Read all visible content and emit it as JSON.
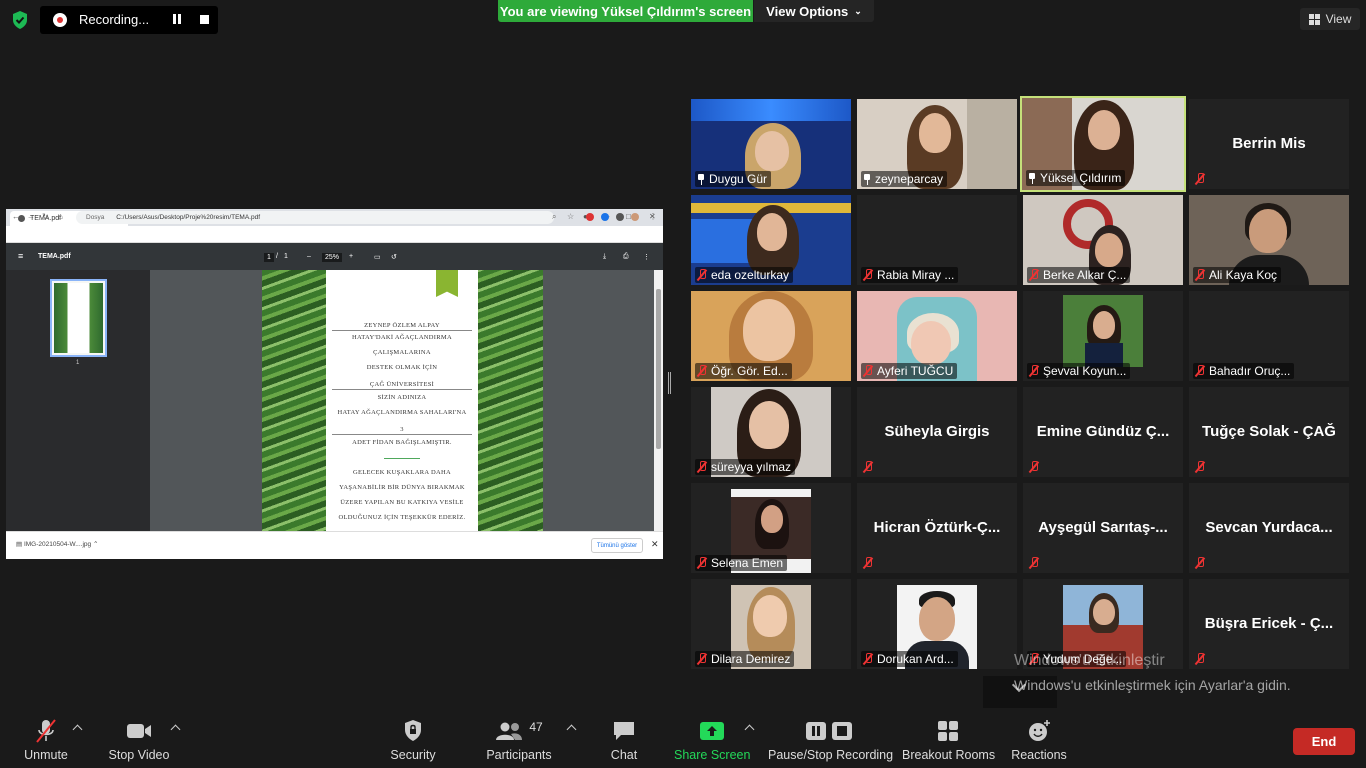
{
  "top": {
    "recording_label": "Recording...",
    "viewing_banner": "You are viewing Yüksel Çıldırım's screen",
    "view_options": "View Options",
    "view": "View"
  },
  "shared_screen": {
    "tab_title": "TEMA.pdf",
    "url_prefix": "Dosya",
    "url": "C:/Users/Asus/Desktop/Proje%20resim/TEMA.pdf",
    "pdf_title": "TEMA.pdf",
    "page_current": "1",
    "page_sep": "/",
    "page_total": "1",
    "zoom": "25%",
    "thumb_page": "1",
    "certificate_lines": [
      "ZEYNEP ÖZLEM ALPAY",
      "HATAY'DAKİ AĞAÇLANDIRMA",
      "ÇALIŞMALARINA",
      "DESTEK OLMAK İÇİN",
      "ÇAĞ ÜNİVERSİTESİ",
      "SİZİN ADINIZA",
      "HATAY AĞAÇLANDIRMA SAHALARI'NA",
      "3",
      "ADET FİDAN BAĞIŞLAMIŞTIR.",
      "GELECEK KUŞAKLARA DAHA",
      "YAŞANABİLİR BİR DÜNYA BIRAKMAK",
      "ÜZERE YAPILAN BU KATKIYA VESİLE",
      "OLDUĞUNUZ İÇİN TEŞEKKÜR EDERİZ."
    ],
    "download_file": "IMG-20210504-W....jpg",
    "show_all": "Tümünü göster"
  },
  "participants": [
    {
      "name": "Duygu Gür",
      "icon": "pin-icon"
    },
    {
      "name": "zeyneparcay",
      "icon": "pin-icon"
    },
    {
      "name": "Yüksel Çıldırım",
      "icon": "pin-icon"
    },
    {
      "name": "Berrin Mis",
      "icon": "mute-icon"
    },
    {
      "name": "eda ozelturkay",
      "icon": "mute-icon"
    },
    {
      "name": "Rabia Miray ...",
      "icon": "mute-icon"
    },
    {
      "name": "Berke Alkar Ç...",
      "icon": "mute-icon"
    },
    {
      "name": "Ali Kaya Koç",
      "icon": "mute-icon"
    },
    {
      "name": "Öğr. Gör. Ed...",
      "icon": "mute-icon"
    },
    {
      "name": "Ayferi TUĞCU",
      "icon": "mute-icon"
    },
    {
      "name": "Şevval Koyun...",
      "icon": "mute-icon"
    },
    {
      "name": "Bahadır Oruç...",
      "icon": "mute-icon"
    },
    {
      "name": "süreyya yılmaz",
      "icon": "mute-icon"
    },
    {
      "name": "Süheyla Girgis",
      "icon": "mute-icon"
    },
    {
      "name": "Emine Gündüz Ç...",
      "icon": "mute-icon"
    },
    {
      "name": "Tuğçe Solak - ÇAĞ",
      "icon": "mute-icon"
    },
    {
      "name": "Selena Emen",
      "icon": "mute-icon"
    },
    {
      "name": "Hicran Öztürk-Ç...",
      "icon": "mute-icon"
    },
    {
      "name": "Ayşegül Sarıtaş-...",
      "icon": "mute-icon"
    },
    {
      "name": "Sevcan Yurdaca...",
      "icon": "mute-icon"
    },
    {
      "name": "Dilara Demirez",
      "icon": "mute-icon"
    },
    {
      "name": "Dorukan Ard...",
      "icon": "mute-icon"
    },
    {
      "name": "Yudum Değe...",
      "icon": "mute-icon"
    },
    {
      "name": "Büşra Ericek - Ç...",
      "icon": "mute-icon"
    }
  ],
  "watermark": {
    "line1": "Windows'u Etkinleştir",
    "line2": "Windows'u etkinleştirmek için Ayarlar'a gidin."
  },
  "toolbar": {
    "unmute": "Unmute",
    "stop_video": "Stop Video",
    "security": "Security",
    "participants": "Participants",
    "participant_count": "47",
    "chat": "Chat",
    "share_screen": "Share Screen",
    "pause_stop_recording": "Pause/Stop Recording",
    "breakout_rooms": "Breakout Rooms",
    "reactions": "Reactions",
    "end": "End"
  },
  "colors": {
    "banner_green": "#2eaa3a",
    "share_green": "#23d959",
    "end_red": "#c52a25",
    "active_speaker": "#c5e17a",
    "muted_red": "#e33333"
  }
}
